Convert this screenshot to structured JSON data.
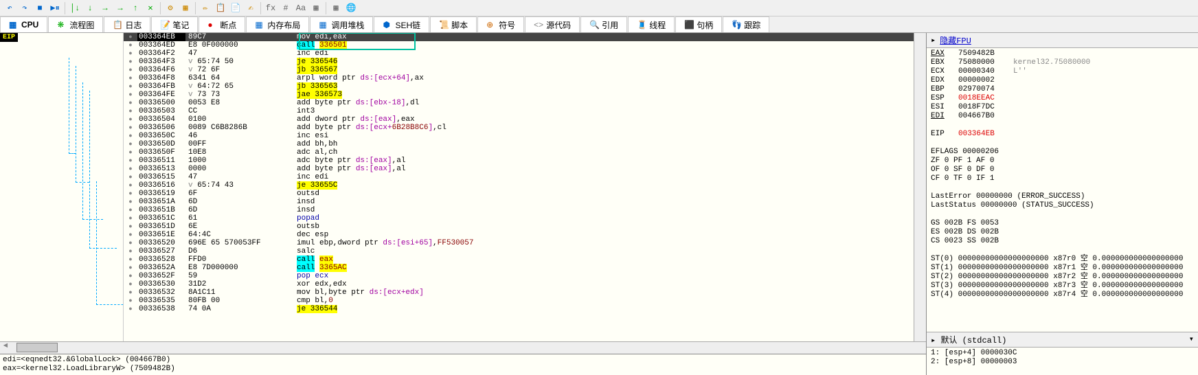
{
  "toolbar_icons": [
    "↶",
    "↷",
    "■",
    "▶⏸",
    "│↓",
    "↓",
    "→",
    "→",
    "↑",
    "✕",
    "⚙",
    "▦",
    "✏",
    "📋",
    "📄",
    "✍",
    "fx",
    "#",
    "Aa",
    "▦",
    "▦",
    "🌐"
  ],
  "tabs": [
    {
      "icon": "▦",
      "label": "CPU",
      "color": "#06c"
    },
    {
      "icon": "❋",
      "label": "流程图",
      "color": "#0a0"
    },
    {
      "icon": "📋",
      "label": "日志",
      "color": "#c90"
    },
    {
      "icon": "📝",
      "label": "笔记",
      "color": "#06c"
    },
    {
      "icon": "●",
      "label": "断点",
      "color": "#d00"
    },
    {
      "icon": "▦",
      "label": "内存布局",
      "color": "#06c"
    },
    {
      "icon": "▦",
      "label": "调用堆栈",
      "color": "#06c"
    },
    {
      "icon": "⬢",
      "label": "SEH链",
      "color": "#06c"
    },
    {
      "icon": "📜",
      "label": "脚本",
      "color": "#888"
    },
    {
      "icon": "⊕",
      "label": "符号",
      "color": "#c60"
    },
    {
      "icon": "<>",
      "label": "源代码",
      "color": "#888"
    },
    {
      "icon": "🔍",
      "label": "引用",
      "color": "#06c"
    },
    {
      "icon": "🧵",
      "label": "线程",
      "color": "#c00"
    },
    {
      "icon": "⬛",
      "label": "句柄",
      "color": "#c00"
    },
    {
      "icon": "👣",
      "label": "跟踪",
      "color": "#c00"
    }
  ],
  "eip_label": "EIP",
  "disasm": [
    {
      "addr": "003364EB",
      "bytes": "89C7",
      "mnem": "mov edi,eax",
      "current": true,
      "boxtop": true
    },
    {
      "addr": "003364ED",
      "bytes": "E8 0F000000",
      "mnem": "call 336501",
      "call": true,
      "boxbot": true
    },
    {
      "addr": "003364F2",
      "bytes": "47",
      "mnem": "inc edi"
    },
    {
      "addr": "003364F3",
      "bytes": "65:74 50",
      "pre": "v",
      "mnem": "je 336546",
      "jmp": true
    },
    {
      "addr": "003364F6",
      "bytes": "72 6F",
      "pre": "v",
      "mnem": "jb 336567",
      "jmp": true
    },
    {
      "addr": "003364F8",
      "bytes": "6341 64",
      "mnem": "arpl word ptr ds:[ecx+64],ax",
      "dsptr": true
    },
    {
      "addr": "003364FB",
      "bytes": "64:72 65",
      "pre": "v",
      "mnem": "jb 336563",
      "jmp": true
    },
    {
      "addr": "003364FE",
      "bytes": "73 73",
      "pre": "v",
      "mnem": "jae 336573",
      "jmp": true
    },
    {
      "addr": "00336500",
      "bytes": "0053 E8",
      "mnem": "add byte ptr ds:[ebx-18],dl",
      "dsptr": true
    },
    {
      "addr": "00336503",
      "bytes": "CC",
      "mnem": "int3"
    },
    {
      "addr": "00336504",
      "bytes": "0100",
      "mnem": "add dword ptr ds:[eax],eax",
      "dsptr": true
    },
    {
      "addr": "00336506",
      "bytes": "0089 C6B8286B",
      "mnem": "add byte ptr ds:[ecx+6B28B8C6],cl",
      "dsptr": true
    },
    {
      "addr": "0033650C",
      "bytes": "46",
      "mnem": "inc esi"
    },
    {
      "addr": "0033650D",
      "bytes": "00FF",
      "mnem": "add bh,bh"
    },
    {
      "addr": "0033650F",
      "bytes": "10E8",
      "mnem": "adc al,ch"
    },
    {
      "addr": "00336511",
      "bytes": "1000",
      "mnem": "adc byte ptr ds:[eax],al",
      "dsptr": true
    },
    {
      "addr": "00336513",
      "bytes": "0000",
      "mnem": "add byte ptr ds:[eax],al",
      "dsptr": true
    },
    {
      "addr": "00336515",
      "bytes": "47",
      "mnem": "inc edi"
    },
    {
      "addr": "00336516",
      "bytes": "65:74 43",
      "pre": "v",
      "mnem": "je 33655C",
      "jmp": true
    },
    {
      "addr": "00336519",
      "bytes": "6F",
      "mnem": "outsd"
    },
    {
      "addr": "0033651A",
      "bytes": "6D",
      "mnem": "insd"
    },
    {
      "addr": "0033651B",
      "bytes": "6D",
      "mnem": "insd"
    },
    {
      "addr": "0033651C",
      "bytes": "61",
      "mnem": "popad",
      "pop": true
    },
    {
      "addr": "0033651D",
      "bytes": "6E",
      "mnem": "outsb"
    },
    {
      "addr": "0033651E",
      "bytes": "64:4C",
      "mnem": "dec esp"
    },
    {
      "addr": "00336520",
      "bytes": "696E 65 570053FF",
      "mnem": "imul ebp,dword ptr ds:[esi+65],FF530057",
      "dsptr": true
    },
    {
      "addr": "00336527",
      "bytes": "D6",
      "mnem": "salc"
    },
    {
      "addr": "00336528",
      "bytes": "FFD0",
      "mnem": "call eax",
      "call": true
    },
    {
      "addr": "0033652A",
      "bytes": "E8 7D000000",
      "mnem": "call 3365AC",
      "call": true
    },
    {
      "addr": "0033652F",
      "bytes": "59",
      "mnem": "pop ecx",
      "pop": true
    },
    {
      "addr": "00336530",
      "bytes": "31D2",
      "mnem": "xor edx,edx"
    },
    {
      "addr": "00336532",
      "bytes": "8A1C11",
      "mnem": "mov bl,byte ptr ds:[ecx+edx]",
      "dsptr": true
    },
    {
      "addr": "00336535",
      "bytes": "80FB 00",
      "mnem": "cmp bl,0"
    },
    {
      "addr": "00336538",
      "bytes": "74 0A",
      "mnem": "je 336544",
      "jmp": true
    }
  ],
  "info": {
    "line1": "edi=<eqnedt32.&GlobalLock> (004667B0)",
    "line2": "eax=<kernel32.LoadLibraryW> (7509482B)"
  },
  "reg_header": {
    "hide": "隐藏FPU"
  },
  "registers": [
    {
      "name": "EAX",
      "u": true,
      "val": "7509482B",
      "desc": "<kernel32.LoadLibraryW>"
    },
    {
      "name": "EBX",
      "val": "75080000",
      "desc": "kernel32.75080000"
    },
    {
      "name": "ECX",
      "val": "00000340",
      "desc": "L''"
    },
    {
      "name": "EDX",
      "val": "00000002",
      "desc": ""
    },
    {
      "name": "EBP",
      "val": "02970074",
      "desc": ""
    },
    {
      "name": "ESP",
      "val": "0018EEAC",
      "desc": "",
      "red": true
    },
    {
      "name": "ESI",
      "val": "0018F7DC",
      "desc": ""
    },
    {
      "name": "EDI",
      "u": true,
      "val": "004667B0",
      "desc": "<eqnedt32.&GlobalLock>"
    }
  ],
  "eip": {
    "name": "EIP",
    "val": "003364EB"
  },
  "eflags": "EFLAGS   00000206",
  "flags": [
    "ZF 0  PF 1  AF 0",
    "OF 0  SF 0  DF 0",
    "CF 0  TF 0  IF 1"
  ],
  "lasterror": "LastError  00000000 (ERROR_SUCCESS)",
  "laststatus": "LastStatus 00000000 (STATUS_SUCCESS)",
  "segs": [
    "GS 002B  FS 0053",
    "ES 002B  DS 002B",
    "CS 0023  SS 002B"
  ],
  "fpu": [
    "ST(0) 00000000000000000000 x87r0 空 0.000000000000000000",
    "ST(1) 00000000000000000000 x87r1 空 0.000000000000000000",
    "ST(2) 00000000000000000000 x87r2 空 0.000000000000000000",
    "ST(3) 00000000000000000000 x87r3 空 0.000000000000000000",
    "ST(4) 00000000000000000000 x87r4 空 0.000000000000000000"
  ],
  "stack_header": "默认 (stdcall)",
  "stack": [
    "1: [esp+4] 0000030C",
    "2: [esp+8] 00000003"
  ]
}
